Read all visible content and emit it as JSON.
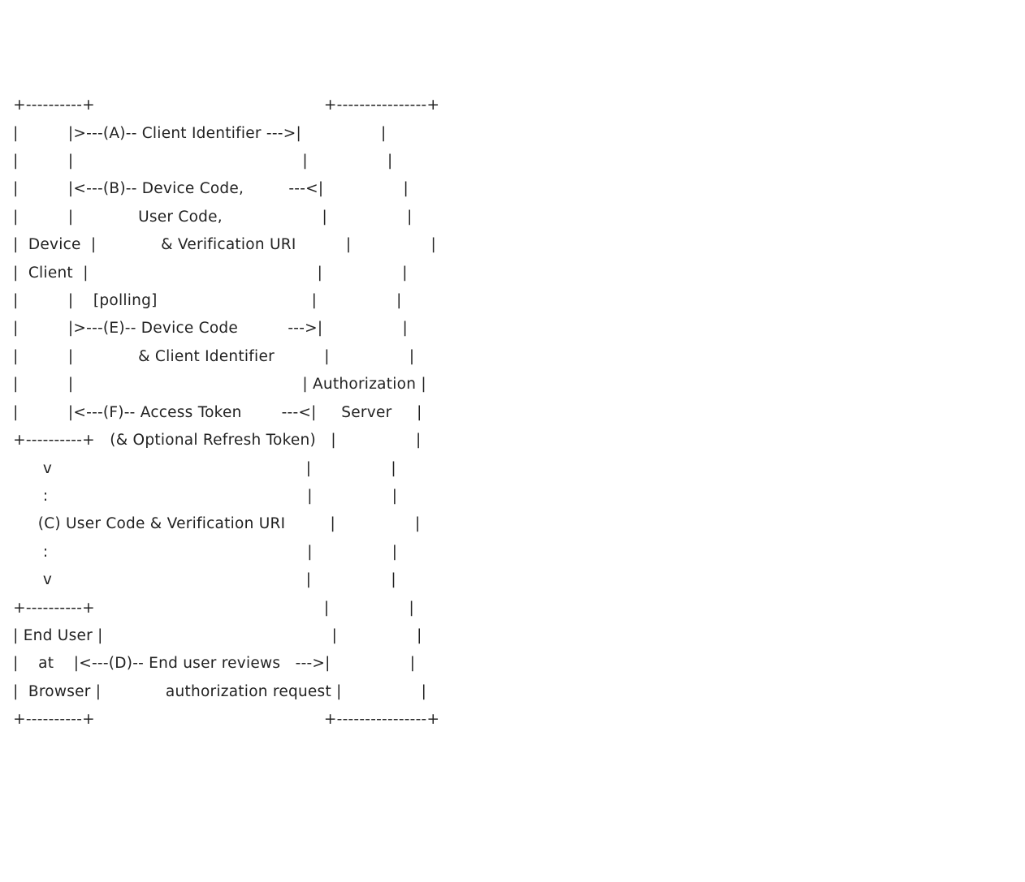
{
  "diagram": {
    "leftBox1": {
      "line1": "Device",
      "line2": "Client"
    },
    "leftBox2": {
      "line1": "End User",
      "line2": "at",
      "line3": "Browser"
    },
    "rightBox": {
      "line1": "Authorization",
      "line2": "Server"
    },
    "flows": {
      "A": {
        "label": "(A)",
        "text": "Client Identifier",
        "dir": ">--- --->"
      },
      "B": {
        "label": "(B)",
        "text": "Device Code,",
        "text2": "User Code,",
        "text3": "& Verification URI",
        "dir": "<--- ---<"
      },
      "polling": "[polling]",
      "E": {
        "label": "(E)",
        "text": "Device Code",
        "text2": "& Client Identifier",
        "dir": ">--- --->"
      },
      "F": {
        "label": "(F)",
        "text": "Access Token",
        "text2": "(& Optional Refresh Token)",
        "dir": "<--- ---<"
      },
      "C": {
        "label": "(C)",
        "text": "User Code & Verification URI"
      },
      "D": {
        "label": "(D)",
        "text": "End user reviews",
        "text2": "authorization request",
        "dir": "<--- --->"
      }
    },
    "lines": [
      " +----------+                                              +----------------+",
      " |          |>---(A)-- Client Identifier --->|                |",
      " |          |                                              |                |",
      " |          |<---(B)-- Device Code,         ---<|                |",
      " |          |             User Code,                    |                |",
      " |  Device  |             & Verification URI          |                |",
      " |  Client  |                                              |                |",
      " |          |    [polling]                               |                |",
      " |          |>---(E)-- Device Code          --->|                |",
      " |          |             & Client Identifier          |                |",
      " |          |                                              | Authorization |",
      " |          |<---(F)-- Access Token        ---<|     Server     |",
      " +----------+   (& Optional Refresh Token)   |                |",
      "       v                                                   |                |",
      "       :                                                    |                |",
      "      (C) User Code & Verification URI         |                |",
      "       :                                                    |                |",
      "       v                                                   |                |",
      " +----------+                                              |                |",
      " | End User |                                              |                |",
      " |    at    |<---(D)-- End user reviews   --->|                |",
      " |  Browser |             authorization request |                |",
      " +----------+                                              +----------------+"
    ]
  }
}
